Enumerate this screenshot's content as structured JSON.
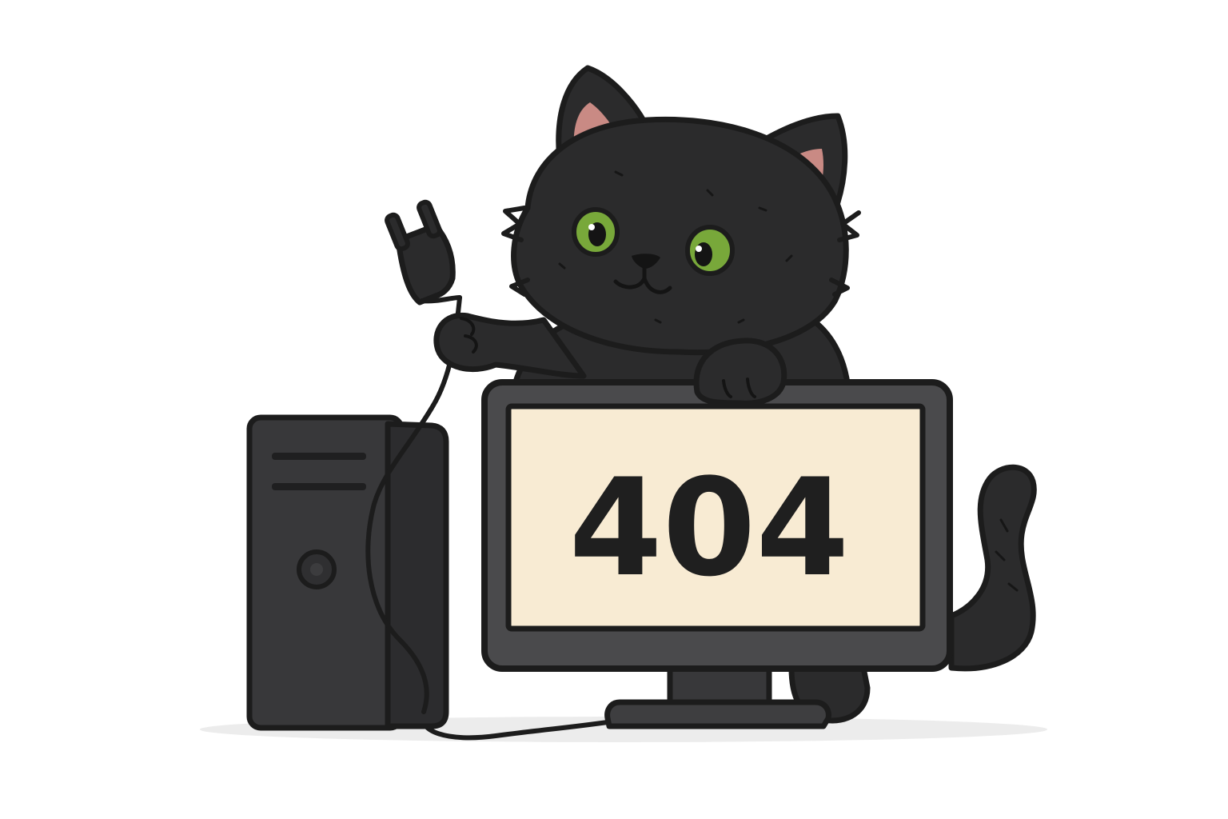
{
  "screen": {
    "code": "404"
  },
  "colors": {
    "background": "#ffffff",
    "outline": "#1c1c1c",
    "cat_fur": "#2b2b2c",
    "cat_fur_shade": "#1f1f20",
    "ear_inner": "#c98a84",
    "eye_iris": "#78a83a",
    "pc_body": "#38383a",
    "pc_side": "#2c2c2e",
    "monitor_bezel": "#4a4a4c",
    "screen_bg": "#f8ebd3",
    "text": "#1f1f1f",
    "shadow": "#ececec"
  },
  "icons": {
    "plug": "plug-icon",
    "power": "power-button-icon"
  }
}
